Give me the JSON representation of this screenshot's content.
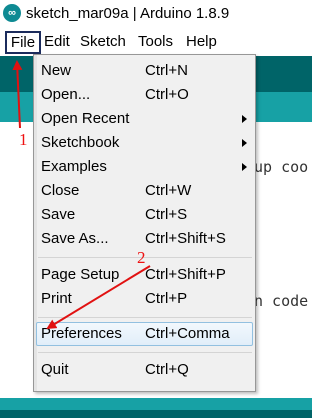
{
  "window": {
    "title": "sketch_mar09a | Arduino 1.8.9",
    "app_icon_glyph": "∞"
  },
  "menubar": {
    "items": [
      "File",
      "Edit",
      "Sketch",
      "Tools",
      "Help"
    ]
  },
  "editor": {
    "line1_fragment": "up coo",
    "line2_fragment": "n code"
  },
  "file_menu": {
    "items": [
      {
        "label": "New",
        "shortcut": "Ctrl+N",
        "submenu": false
      },
      {
        "label": "Open...",
        "shortcut": "Ctrl+O",
        "submenu": false
      },
      {
        "label": "Open Recent",
        "shortcut": "",
        "submenu": true
      },
      {
        "label": "Sketchbook",
        "shortcut": "",
        "submenu": true
      },
      {
        "label": "Examples",
        "shortcut": "",
        "submenu": true
      },
      {
        "label": "Close",
        "shortcut": "Ctrl+W",
        "submenu": false
      },
      {
        "label": "Save",
        "shortcut": "Ctrl+S",
        "submenu": false
      },
      {
        "label": "Save As...",
        "shortcut": "Ctrl+Shift+S",
        "submenu": false
      },
      {
        "label": "Page Setup",
        "shortcut": "Ctrl+Shift+P",
        "submenu": false
      },
      {
        "label": "Print",
        "shortcut": "Ctrl+P",
        "submenu": false
      },
      {
        "label": "Preferences",
        "shortcut": "Ctrl+Comma",
        "submenu": false,
        "highlighted": true
      },
      {
        "label": "Quit",
        "shortcut": "Ctrl+Q",
        "submenu": false
      }
    ]
  },
  "annotations": {
    "step1": "1",
    "step2": "2",
    "color": "#e11111"
  },
  "colors": {
    "toolbar": "#006468",
    "tabs": "#17a1a5",
    "highlight_border": "#92c0e0"
  }
}
